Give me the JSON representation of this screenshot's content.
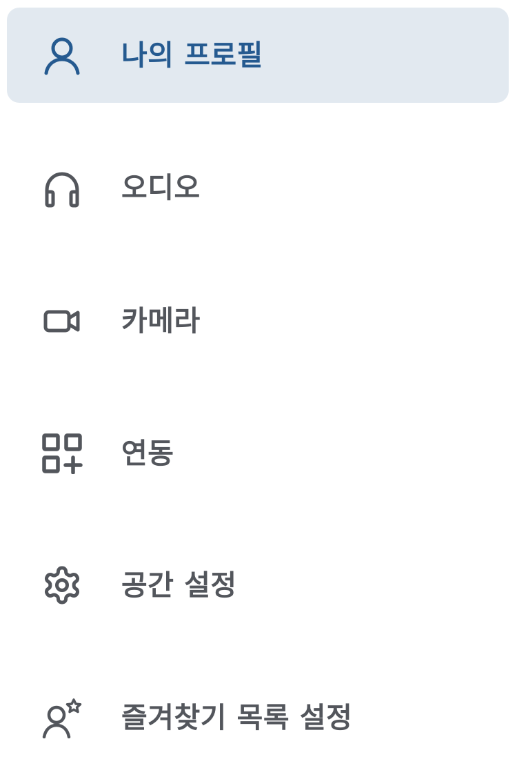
{
  "menu": {
    "items": [
      {
        "label": "나의 프로필",
        "icon": "person-icon",
        "selected": true
      },
      {
        "label": "오디오",
        "icon": "headphones-icon",
        "selected": false
      },
      {
        "label": "카메라",
        "icon": "video-camera-icon",
        "selected": false
      },
      {
        "label": "연동",
        "icon": "apps-add-icon",
        "selected": false
      },
      {
        "label": "공간 설정",
        "icon": "gear-icon",
        "selected": false
      },
      {
        "label": "즐겨찾기 목록 설정",
        "icon": "person-star-icon",
        "selected": false
      }
    ]
  },
  "colors": {
    "selected_background": "#e2e9f0",
    "selected_text": "#255a90",
    "default_text": "#53565c"
  }
}
